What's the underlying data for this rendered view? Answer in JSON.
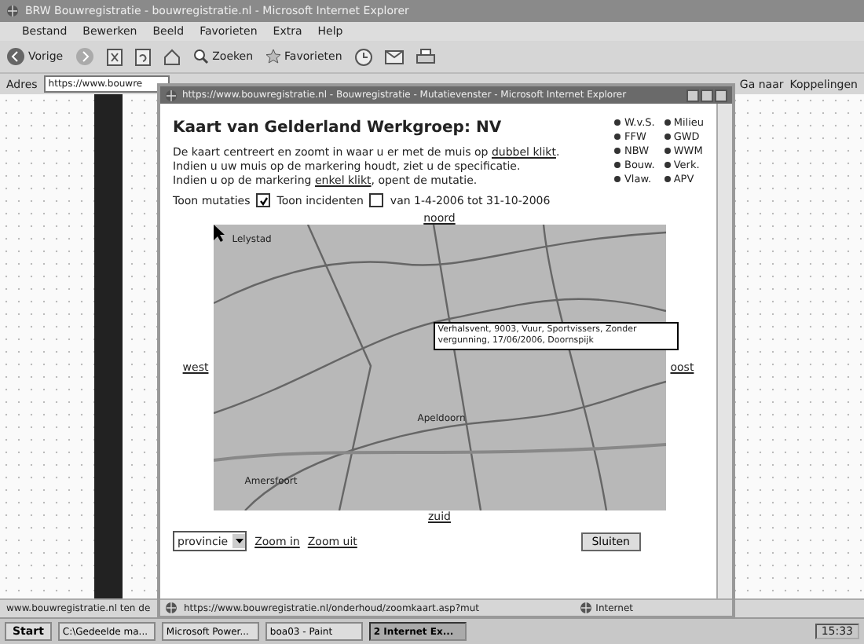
{
  "browser": {
    "title": "BRW Bouwregistratie - bouwregistratie.nl - Microsoft Internet Explorer",
    "menu": [
      "Bestand",
      "Bewerken",
      "Beeld",
      "Favorieten",
      "Extra",
      "Help"
    ],
    "toolbar": [
      "Vorige",
      "Zoeken",
      "Favorieten"
    ],
    "address_label": "Adres",
    "address": "https://www.bouwre",
    "go": "Ga naar",
    "links": "Koppelingen",
    "status": "www.bouwregistratie.nl ten de"
  },
  "popup": {
    "title": "https://www.bouwregistratie.nl - Bouwregistratie - Mutatievenster - Microsoft Internet Explorer",
    "heading": "Kaart van Gelderland Werkgroep: NV",
    "instructions": [
      "De kaart centreert en zoomt in waar u er met de muis op **dubbel klikt**.",
      "Indien u uw muis op de markering houdt, ziet u de specificatie.",
      "Indien u op de markering **enkel klikt**, opent de mutatie."
    ],
    "legend": [
      {
        "label": "W.v.S."
      },
      {
        "label": "Milieu"
      },
      {
        "label": "FFW"
      },
      {
        "label": "GWD"
      },
      {
        "label": "NBW"
      },
      {
        "label": "WWM"
      },
      {
        "label": "Bouw."
      },
      {
        "label": "Verk."
      },
      {
        "label": "Vlaw."
      },
      {
        "label": "APV"
      }
    ],
    "filters": [
      {
        "label": "Toon mutaties",
        "checked": true
      },
      {
        "label": "Toon incidenten",
        "checked": false
      }
    ],
    "period": "van 1-4-2006 tot 31-10-2006",
    "nav": {
      "north": "noord",
      "west": "west",
      "east": "oost",
      "south": "zuid"
    },
    "places": [
      "Lelystad",
      "Apeldoorn",
      "Amersfoort"
    ],
    "tooltip": "Verhalsvent, 9003, Vuur, Sportvissers, Zonder vergunning, 17/06/2006, Doornspijk",
    "select": "provincie",
    "zoom_in": "Zoom in",
    "zoom_out": "Zoom uit",
    "close": "Sluiten",
    "status_url": "https://www.bouwregistratie.nl/onderhoud/zoomkaart.asp?mut",
    "zone": "Internet"
  },
  "taskbar": {
    "start": "Start",
    "tasks": [
      {
        "label": "C:\\Gedeelde ma...",
        "selected": false
      },
      {
        "label": "Microsoft Power...",
        "selected": false
      },
      {
        "label": "boa03 - Paint",
        "selected": false
      },
      {
        "label": "2 Internet Ex...",
        "selected": true
      }
    ],
    "clock": "15:33"
  }
}
